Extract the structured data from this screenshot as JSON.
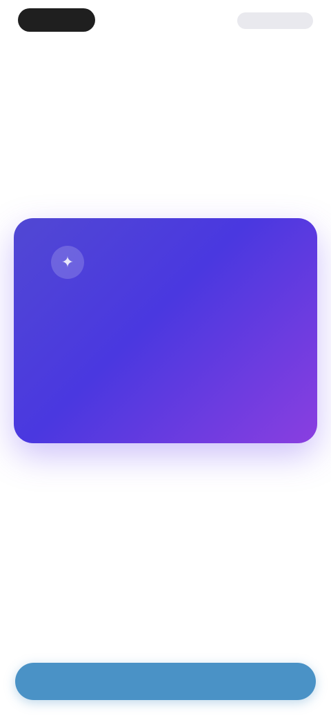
{
  "header": {
    "left_pill": "",
    "right_pill": ""
  },
  "card": {
    "icon": "sparkle-icon",
    "eyebrow": "",
    "title": "",
    "body": ""
  },
  "footer": {
    "primary_label": ""
  },
  "colors": {
    "card_gradient_start": "#5148d3",
    "card_gradient_end": "#8a3fe0",
    "primary_button": "#4a92c6"
  }
}
